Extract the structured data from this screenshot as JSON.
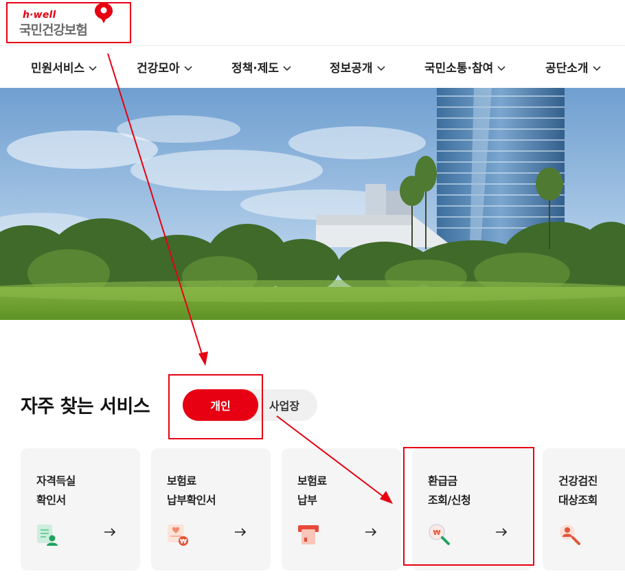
{
  "logo": {
    "brand": "h·well",
    "name": "국민건강보험"
  },
  "nav": {
    "items": [
      {
        "label": "민원서비스"
      },
      {
        "label": "건강모아"
      },
      {
        "label": "정책·제도"
      },
      {
        "label": "정보공개"
      },
      {
        "label": "국민소통·참여"
      },
      {
        "label": "공단소개"
      }
    ]
  },
  "services": {
    "title": "자주 찾는 서비스",
    "tab_personal": "개인",
    "tab_business": "사업장",
    "cards": [
      {
        "title": "자격득실\n확인서",
        "icon": "clipboard-person-icon"
      },
      {
        "title": "보험료\n납부확인서",
        "icon": "document-won-icon"
      },
      {
        "title": "보험료\n납부",
        "icon": "card-payment-icon"
      },
      {
        "title": "환급금\n조회/신청",
        "icon": "won-search-icon"
      },
      {
        "title": "건강검진\n대상조회",
        "icon": "person-search-icon"
      }
    ]
  },
  "colors": {
    "brand_red": "#e60012",
    "card_bg": "#f5f5f5",
    "annotation_red": "#e60012"
  }
}
